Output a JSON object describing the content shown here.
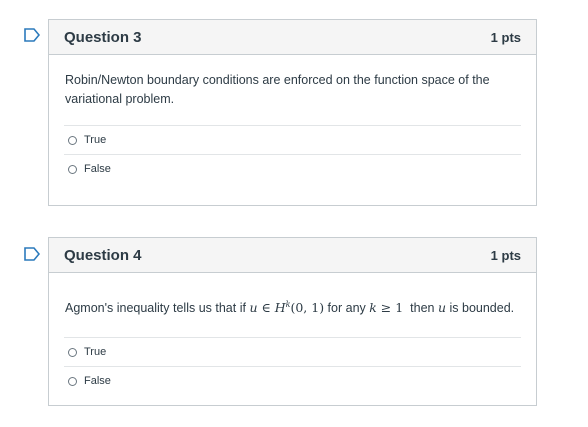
{
  "questions": [
    {
      "title": "Question 3",
      "points": "1 pts",
      "text": "Robin/Newton boundary conditions are enforced on the function space of the variational problem.",
      "options": [
        "True",
        "False"
      ]
    },
    {
      "title": "Question 4",
      "points": "1 pts",
      "text_before": "Agmon's inequality tells us that if ",
      "math_u": "u",
      "math_in": " ∈ ",
      "math_H": "H",
      "math_k": "k",
      "math_interval": "(0, 1)",
      "text_mid": " for any ",
      "math_k2": "k",
      "math_geq": " ≥ 1",
      "text_then": "  then ",
      "math_u2": "u",
      "text_after": " is bounded.",
      "options": [
        "True",
        "False"
      ]
    }
  ],
  "colors": {
    "flag": "#2b7abc",
    "border": "#c7cdd1",
    "header_bg": "#f5f5f5"
  }
}
